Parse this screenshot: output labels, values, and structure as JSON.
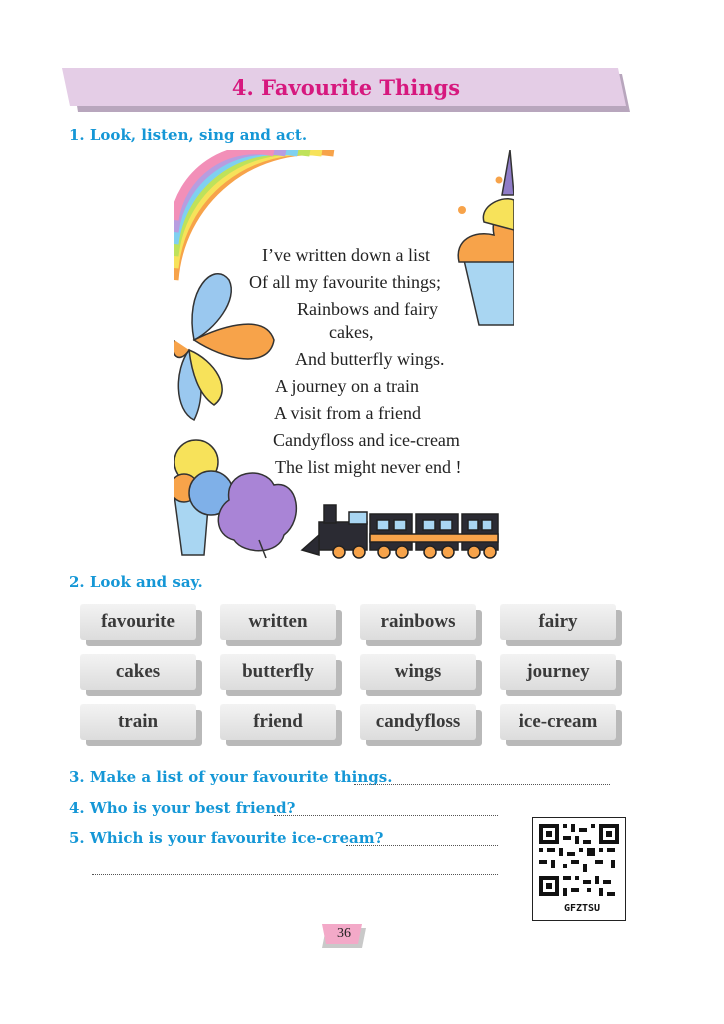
{
  "title": "4. Favourite Things",
  "sections": {
    "s1": "1. Look, listen, sing and act.",
    "s2": "2. Look and say.",
    "q3": "3. Make a list of your favourite things.",
    "q4": "4. Who is your best friend?",
    "q5": "5. Which is your favourite ice-cream?"
  },
  "poem": [
    "I’ve written down a list",
    "Of all my favourite things;",
    "Rainbows and fairy",
    "cakes,",
    "And butterfly wings.",
    "A journey on a train",
    "A visit from a friend",
    "Candyfloss and ice-cream",
    "The list might never end !"
  ],
  "words": [
    "favourite",
    "written",
    "rainbows",
    "fairy",
    "cakes",
    "butterfly",
    "wings",
    "journey",
    "train",
    "friend",
    "candyfloss",
    "ice-cream"
  ],
  "qr_code_text": "GFZTSU",
  "page_number": "36",
  "colors": {
    "title": "#d6187e",
    "banner": "#e4cde6",
    "section": "#1597d6",
    "page_tab": "#f3a9c8"
  }
}
